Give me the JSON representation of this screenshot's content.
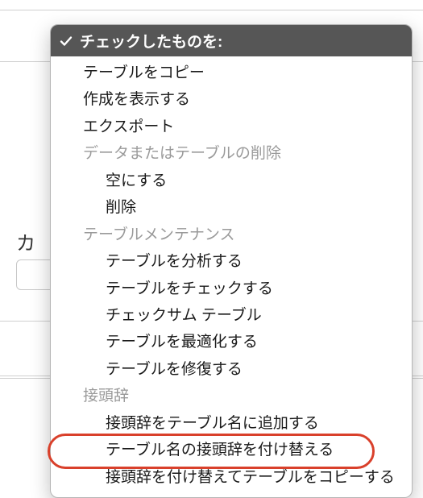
{
  "background": {
    "sidebar_letter": "カ"
  },
  "menu": {
    "header": "チェックしたものを:",
    "items": [
      {
        "kind": "item",
        "label": "テーブルをコピー"
      },
      {
        "kind": "item",
        "label": "作成を表示する"
      },
      {
        "kind": "item",
        "label": "エクスポート"
      },
      {
        "kind": "section",
        "label": "データまたはテーブルの削除"
      },
      {
        "kind": "subitem",
        "label": "空にする"
      },
      {
        "kind": "subitem",
        "label": "削除"
      },
      {
        "kind": "section",
        "label": "テーブルメンテナンス"
      },
      {
        "kind": "subitem",
        "label": "テーブルを分析する"
      },
      {
        "kind": "subitem",
        "label": "テーブルをチェックする"
      },
      {
        "kind": "subitem",
        "label": "チェックサム テーブル"
      },
      {
        "kind": "subitem",
        "label": "テーブルを最適化する"
      },
      {
        "kind": "subitem",
        "label": "テーブルを修復する"
      },
      {
        "kind": "section",
        "label": "接頭辞"
      },
      {
        "kind": "subitem",
        "label": "接頭辞をテーブル名に追加する"
      },
      {
        "kind": "subitem",
        "label": "テーブル名の接頭辞を付け替える",
        "highlighted": true
      },
      {
        "kind": "subitem",
        "label": "接頭辞を付け替えてテーブルをコピーする"
      }
    ]
  }
}
